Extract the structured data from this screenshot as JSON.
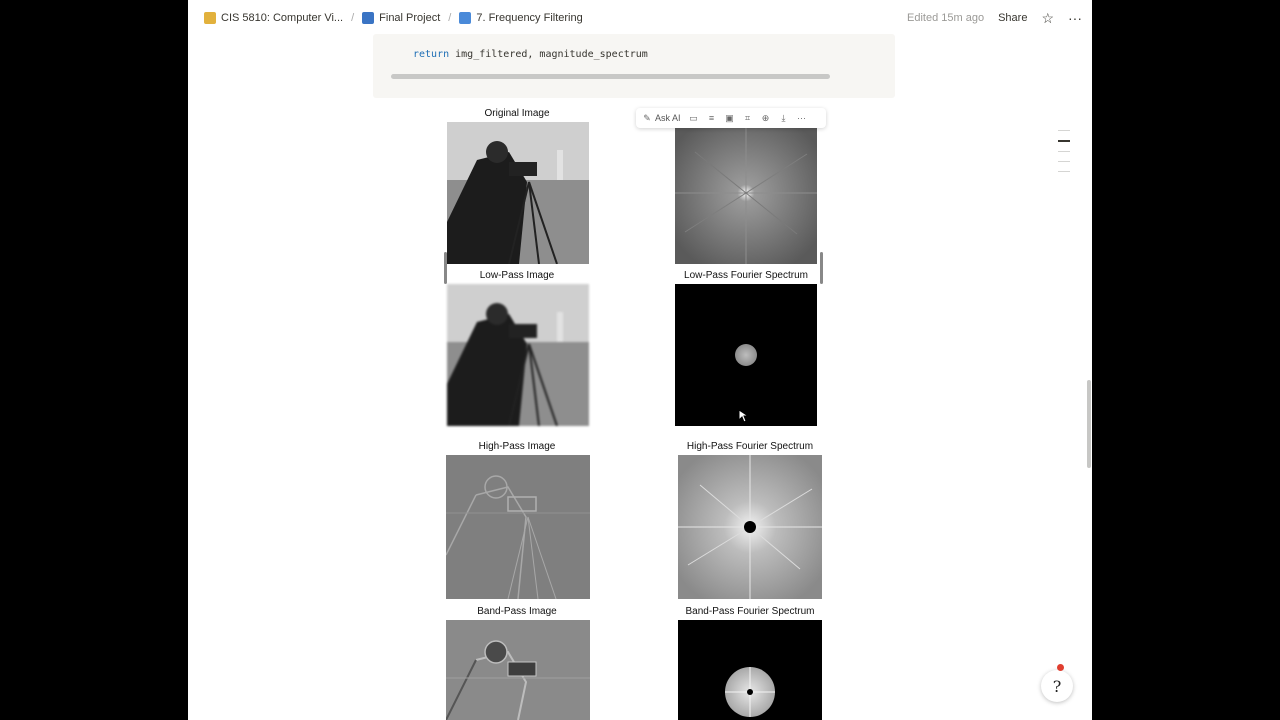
{
  "breadcrumbs": [
    {
      "label": "CIS 5810: Computer Vi...",
      "icon": "folder-icon"
    },
    {
      "label": "Final Project",
      "icon": "book-icon"
    },
    {
      "label": "7. Frequency Filtering",
      "icon": "book-open-icon"
    }
  ],
  "topbar": {
    "edited": "Edited 15m ago",
    "share_label": "Share",
    "favorite_icon": "star-icon",
    "more_icon": "more-dots-icon"
  },
  "code": {
    "keyword": "return",
    "rest": " img_filtered, magnitude_spectrum"
  },
  "image_toolbar": {
    "ask_ai_label": "Ask AI",
    "icons": [
      "comment-icon",
      "align-icon",
      "caption-icon",
      "crop-icon",
      "zoom-icon",
      "download-icon",
      "more-icon"
    ]
  },
  "figure": {
    "titles": {
      "original": "Original Image",
      "low_pass": "Low-Pass Image",
      "low_pass_spectrum": "Low-Pass Fourier Spectrum",
      "high_pass": "High-Pass Image",
      "high_pass_spectrum": "High-Pass Fourier Spectrum",
      "band_pass": "Band-Pass Image",
      "band_pass_spectrum": "Band-Pass Fourier Spectrum"
    }
  },
  "help_button": {
    "icon": "help-icon",
    "glyph": "?"
  },
  "colors": {
    "accent": "#1f6fb5",
    "page_bg": "#ffffff",
    "code_bg": "#f7f6f3"
  }
}
